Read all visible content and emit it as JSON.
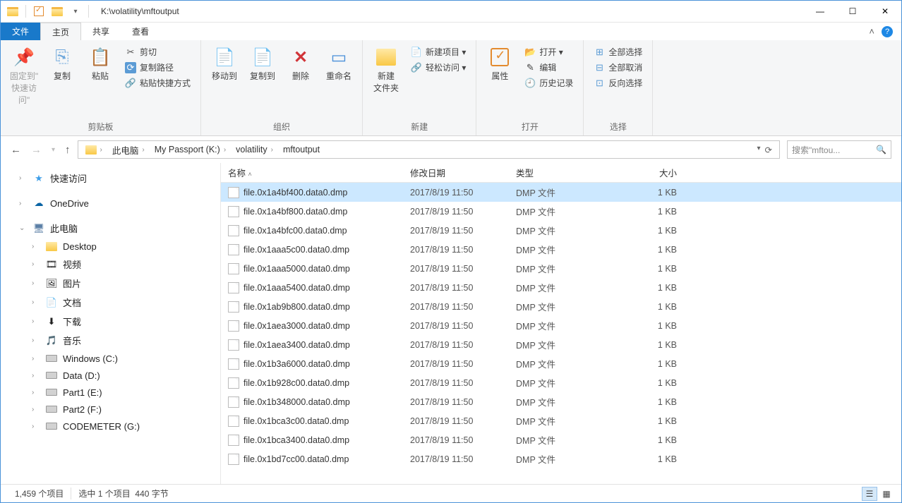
{
  "title": "K:\\volatility\\mftoutput",
  "tabs": {
    "file": "文件",
    "home": "主页",
    "share": "共享",
    "view": "查看"
  },
  "ribbon": {
    "clipboard": {
      "label": "剪贴板",
      "pin": "固定到\"\n快速访问\"",
      "copy": "复制",
      "paste": "粘贴",
      "cut": "剪切",
      "copypath": "复制路径",
      "pasteshortcut": "粘贴快捷方式"
    },
    "organize": {
      "label": "组织",
      "moveto": "移动到",
      "copyto": "复制到",
      "delete": "删除",
      "rename": "重命名"
    },
    "new": {
      "label": "新建",
      "newfolder": "新建\n文件夹",
      "newitem": "新建项目 ▾",
      "easyaccess": "轻松访问 ▾"
    },
    "open": {
      "label": "打开",
      "properties": "属性",
      "open": "打开 ▾",
      "edit": "编辑",
      "history": "历史记录"
    },
    "select": {
      "label": "选择",
      "all": "全部选择",
      "none": "全部取消",
      "invert": "反向选择"
    }
  },
  "breadcrumb": {
    "thispc": "此电脑",
    "drive": "My Passport (K:)",
    "folder1": "volatility",
    "folder2": "mftoutput"
  },
  "search_placeholder": "搜索\"mftou...",
  "nav": {
    "quick": "快速访问",
    "onedrive": "OneDrive",
    "thispc": "此电脑",
    "desktop": "Desktop",
    "videos": "视频",
    "pictures": "图片",
    "documents": "文档",
    "downloads": "下载",
    "music": "音乐",
    "winc": "Windows (C:)",
    "datad": "Data (D:)",
    "part1e": "Part1 (E:)",
    "part2f": "Part2 (F:)",
    "codemg": "CODEMETER (G:)"
  },
  "columns": {
    "name": "名称",
    "date": "修改日期",
    "type": "类型",
    "size": "大小"
  },
  "files": [
    {
      "name": "file.0x1a4bf400.data0.dmp",
      "date": "2017/8/19 11:50",
      "type": "DMP 文件",
      "size": "1 KB",
      "selected": true
    },
    {
      "name": "file.0x1a4bf800.data0.dmp",
      "date": "2017/8/19 11:50",
      "type": "DMP 文件",
      "size": "1 KB"
    },
    {
      "name": "file.0x1a4bfc00.data0.dmp",
      "date": "2017/8/19 11:50",
      "type": "DMP 文件",
      "size": "1 KB"
    },
    {
      "name": "file.0x1aaa5c00.data0.dmp",
      "date": "2017/8/19 11:50",
      "type": "DMP 文件",
      "size": "1 KB"
    },
    {
      "name": "file.0x1aaa5000.data0.dmp",
      "date": "2017/8/19 11:50",
      "type": "DMP 文件",
      "size": "1 KB"
    },
    {
      "name": "file.0x1aaa5400.data0.dmp",
      "date": "2017/8/19 11:50",
      "type": "DMP 文件",
      "size": "1 KB"
    },
    {
      "name": "file.0x1ab9b800.data0.dmp",
      "date": "2017/8/19 11:50",
      "type": "DMP 文件",
      "size": "1 KB"
    },
    {
      "name": "file.0x1aea3000.data0.dmp",
      "date": "2017/8/19 11:50",
      "type": "DMP 文件",
      "size": "1 KB"
    },
    {
      "name": "file.0x1aea3400.data0.dmp",
      "date": "2017/8/19 11:50",
      "type": "DMP 文件",
      "size": "1 KB"
    },
    {
      "name": "file.0x1b3a6000.data0.dmp",
      "date": "2017/8/19 11:50",
      "type": "DMP 文件",
      "size": "1 KB"
    },
    {
      "name": "file.0x1b928c00.data0.dmp",
      "date": "2017/8/19 11:50",
      "type": "DMP 文件",
      "size": "1 KB"
    },
    {
      "name": "file.0x1b348000.data0.dmp",
      "date": "2017/8/19 11:50",
      "type": "DMP 文件",
      "size": "1 KB"
    },
    {
      "name": "file.0x1bca3c00.data0.dmp",
      "date": "2017/8/19 11:50",
      "type": "DMP 文件",
      "size": "1 KB"
    },
    {
      "name": "file.0x1bca3400.data0.dmp",
      "date": "2017/8/19 11:50",
      "type": "DMP 文件",
      "size": "1 KB"
    },
    {
      "name": "file.0x1bd7cc00.data0.dmp",
      "date": "2017/8/19 11:50",
      "type": "DMP 文件",
      "size": "1 KB"
    }
  ],
  "status": {
    "count": "1,459 个项目",
    "selected": "选中 1 个项目",
    "bytes": "440 字节"
  }
}
